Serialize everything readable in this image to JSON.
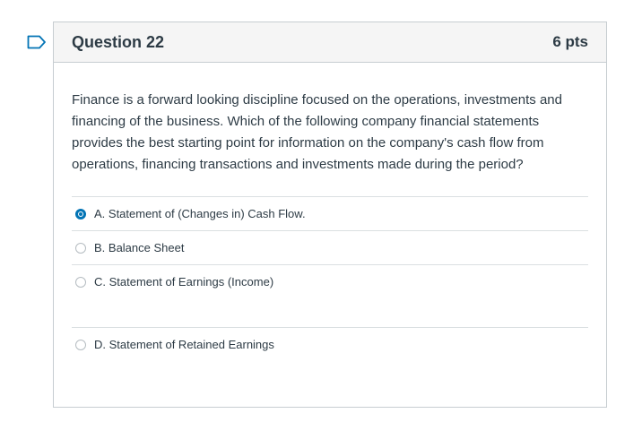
{
  "question": {
    "title": "Question 22",
    "points": "6 pts",
    "text": "Finance is a forward looking discipline focused on the operations, investments and financing of the business. Which of the following company financial statements provides the best starting point for information on the company's cash flow from operations, financing transactions and investments made during the period?",
    "answers": [
      {
        "label": "A. Statement of (Changes in) Cash Flow.",
        "selected": true
      },
      {
        "label": "B. Balance Sheet",
        "selected": false
      },
      {
        "label": "C. Statement of Earnings (Income)",
        "selected": false
      },
      {
        "label": "D.  Statement of Retained Earnings",
        "selected": false
      }
    ]
  },
  "colors": {
    "accent": "#0374b5",
    "header_bg": "#f5f5f5",
    "border": "#c7cdd1",
    "text": "#2d3b45"
  },
  "icons": {
    "flag": "bookmark-flag-icon"
  }
}
